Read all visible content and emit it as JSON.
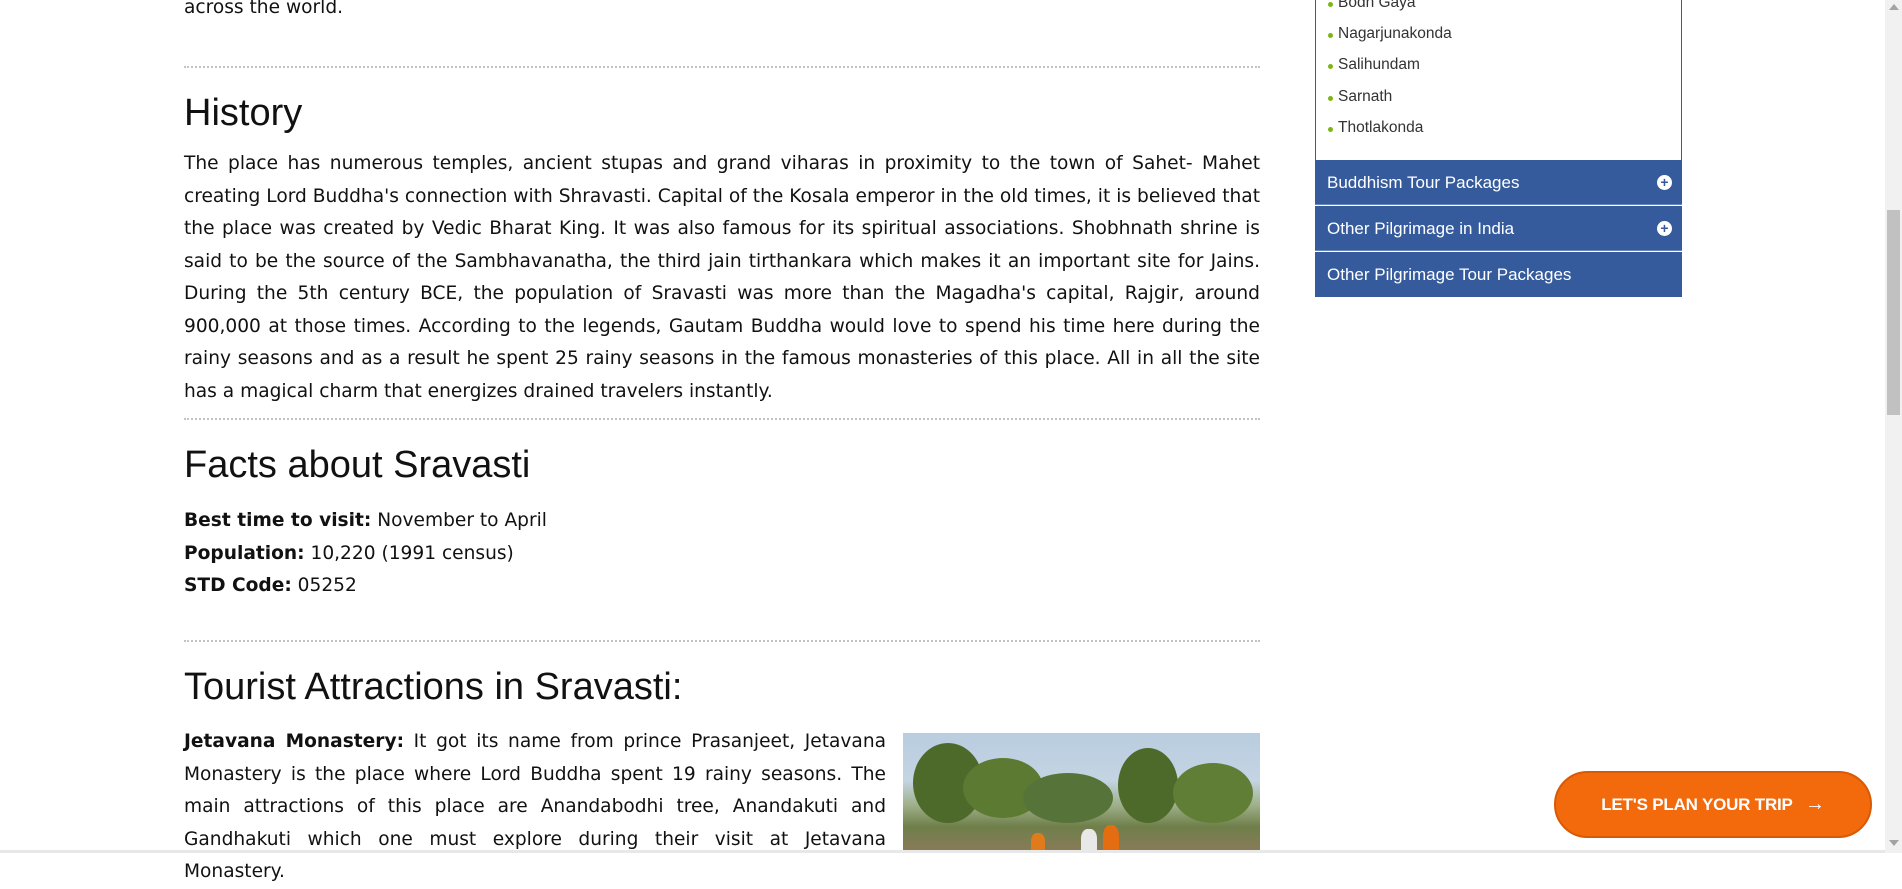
{
  "intro_tail": "across the world.",
  "history": {
    "heading": "History",
    "text": "The place has numerous temples, ancient stupas and grand viharas in proximity to the town of Sahet- Mahet creating Lord Buddha's connection with Shravasti. Capital of the Kosala emperor in the old times, it is believed that the place was created by Vedic Bharat King. It was also famous for its spiritual associations. Shobhnath shrine is said to be the source of the Sambhavanatha, the third jain tirthankara which makes it an important site for Jains. During the 5th century BCE, the population of Sravasti was more than the Magadha's capital, Rajgir, around 900,000 at those times. According to the legends, Gautam Buddha would love to spend his time here during the rainy seasons and as a result he spent 25 rainy seasons in the famous monasteries of this place. All in all the site has a magical charm that energizes drained travelers instantly."
  },
  "facts": {
    "heading": "Facts about Sravasti",
    "best_time_label": "Best time to visit:",
    "best_time_value": " November to April",
    "population_label": "Population:",
    "population_value": " 10,220 (1991 census)",
    "std_label": "STD Code:",
    "std_value": " 05252"
  },
  "attractions": {
    "heading": "Tourist Attractions in Sravasti:",
    "jetavana_label": "Jetavana Monastery:",
    "jetavana_text": " It got its name from prince Prasanjeet, Jetavana Monastery is the place where Lord Buddha spent 19 rainy seasons. The main attractions of this place are Anandabodhi tree, Anandakuti and Gandhakuti which one must explore during their visit at Jetavana Monastery."
  },
  "sidebar": {
    "places": [
      "Bodh Gaya",
      "Nagarjunakonda",
      "Salihundam",
      "Sarnath",
      "Thotlakonda"
    ],
    "accordion": [
      {
        "label": "Buddhism Tour Packages",
        "icon": "plus-circle-icon"
      },
      {
        "label": "Other Pilgrimage in India",
        "icon": "plus-circle-icon"
      },
      {
        "label": "Other Pilgrimage Tour Packages"
      }
    ],
    "plus_glyph": "+"
  },
  "cta": {
    "label": "LET'S PLAN YOUR TRIP",
    "arrow": "→"
  },
  "colors": {
    "accent_blue": "#365b9c",
    "cta_orange": "#f26a0c",
    "bullet_green": "#7cb518"
  }
}
